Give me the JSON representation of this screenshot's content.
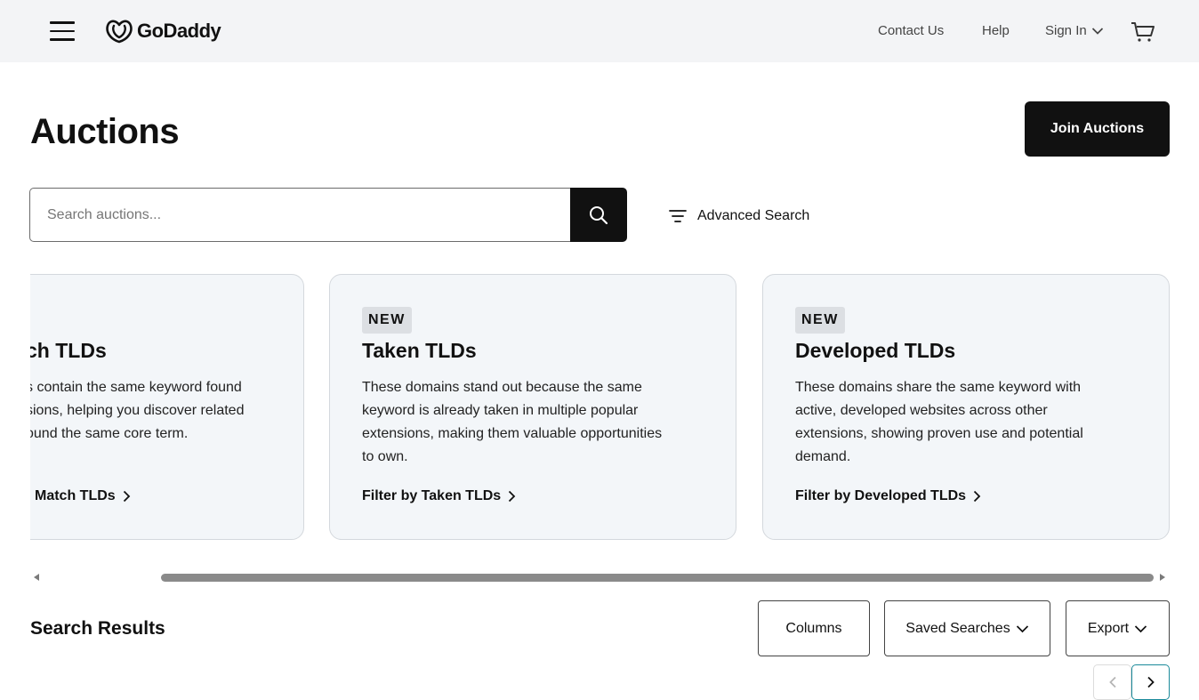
{
  "header": {
    "logo_text": "GoDaddy",
    "nav": {
      "contact": "Contact Us",
      "help": "Help",
      "sign_in": "Sign In"
    }
  },
  "page": {
    "title": "Auctions",
    "join_label": "Join Auctions"
  },
  "search": {
    "placeholder": "Search auctions...",
    "advanced_label": "Advanced Search"
  },
  "cards": [
    {
      "badge": "",
      "title": "ch TLDs",
      "description": "s contain the same keyword found sions, helping you discover related ound the same core term.",
      "lines": [
        "s contain the same keyword found",
        "sions, helping you discover related",
        "ound the same core term."
      ],
      "link": "Match TLDs"
    },
    {
      "badge": "NEW",
      "title": "Taken TLDs",
      "lines": [
        "These domains stand out because the same",
        "keyword is already taken in multiple popular",
        "extensions, making them valuable opportunities",
        "to own."
      ],
      "link": "Filter by Taken TLDs"
    },
    {
      "badge": "NEW",
      "title": "Developed TLDs",
      "lines": [
        "These domains share the same keyword with",
        "active, developed websites across other",
        "extensions, showing proven use and potential",
        "demand."
      ],
      "link": "Filter by Developed TLDs"
    }
  ],
  "results": {
    "title": "Search Results",
    "columns_label": "Columns",
    "saved_searches_label": "Saved Searches",
    "export_label": "Export"
  },
  "colors": {
    "header_bg": "#f3f4f6",
    "primary_button": "#111111",
    "card_bg": "#f3f6f9",
    "accent_teal": "#1a8a9a"
  },
  "icons": [
    "hamburger-icon",
    "godaddy-logo-icon",
    "chevron-down-icon",
    "cart-icon",
    "search-icon",
    "filter-icon",
    "chevron-right-icon",
    "chevron-left-icon"
  ]
}
